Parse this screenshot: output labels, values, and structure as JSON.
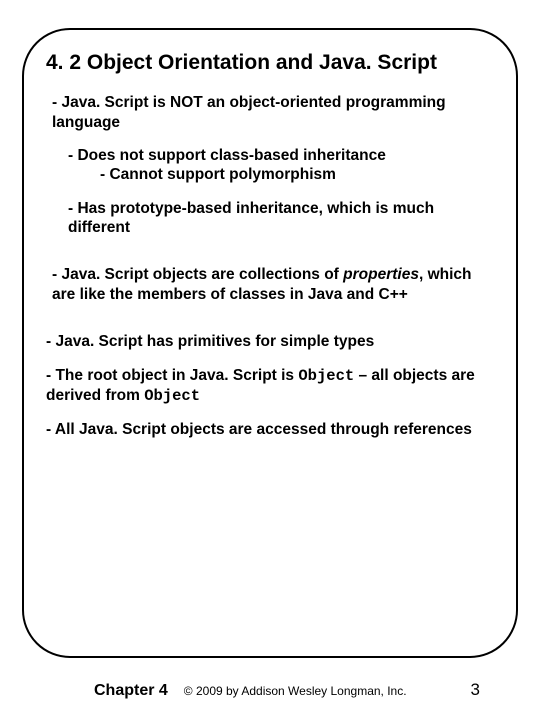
{
  "slide": {
    "title": "4. 2 Object Orientation and Java. Script",
    "p1": "- Java. Script is NOT an object-oriented programming language",
    "p2": "- Does not support class-based inheritance",
    "p3": "- Cannot support polymorphism",
    "p4": "- Has prototype-based inheritance, which is much different",
    "p5a": "- Java. Script objects are collections of ",
    "p5b": "properties",
    "p5c": ", which are like the members of classes in Java and C++",
    "p6": "- Java. Script has primitives for simple types",
    "p7a": "- The root object in Java. Script is ",
    "p7b": "Object",
    "p7c": " – all objects are derived from ",
    "p7d": "Object",
    "p8": "- All Java. Script objects are accessed through references"
  },
  "footer": {
    "chapter": "Chapter 4",
    "copyright": "© 2009 by Addison Wesley Longman, Inc.",
    "page": "3"
  }
}
